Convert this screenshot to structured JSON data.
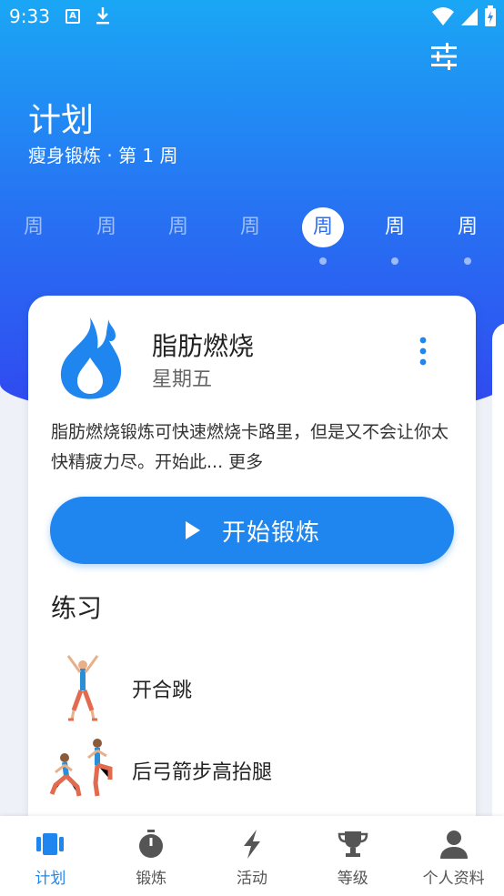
{
  "status_bar": {
    "time": "9:33"
  },
  "header": {
    "title": "计划",
    "subtitle": "瘦身锻炼 · 第 1 周"
  },
  "weeks": [
    {
      "label": "周",
      "state": "inactive"
    },
    {
      "label": "周",
      "state": "inactive"
    },
    {
      "label": "周",
      "state": "inactive"
    },
    {
      "label": "周",
      "state": "inactive"
    },
    {
      "label": "周",
      "state": "active"
    },
    {
      "label": "周",
      "state": "done"
    },
    {
      "label": "周",
      "state": "done"
    }
  ],
  "workout": {
    "title": "脂肪燃烧",
    "day": "星期五",
    "description": "脂肪燃烧锻炼可快速燃烧卡路里，但是又不会让你太快精疲力尽。开始此... 更多",
    "start_label": "开始锻炼",
    "icon": "flame-icon"
  },
  "exercises_section": {
    "title": "练习",
    "items": [
      {
        "name": "开合跳"
      },
      {
        "name": "后弓箭步高抬腿"
      }
    ]
  },
  "bottom_nav": [
    {
      "label": "计划",
      "icon": "plan-icon",
      "active": true
    },
    {
      "label": "锻炼",
      "icon": "stopwatch-icon",
      "active": false
    },
    {
      "label": "活动",
      "icon": "lightning-icon",
      "active": false
    },
    {
      "label": "等级",
      "icon": "trophy-icon",
      "active": false
    },
    {
      "label": "个人资料",
      "icon": "person-icon",
      "active": false
    }
  ],
  "colors": {
    "accent": "#1f86f0",
    "gradient_top": "#1aa7f5",
    "gradient_bottom": "#3147f0"
  }
}
